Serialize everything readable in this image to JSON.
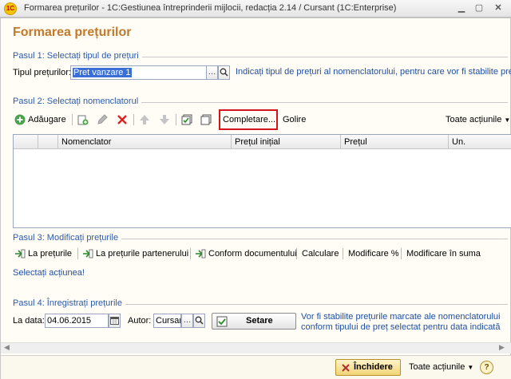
{
  "window": {
    "title": "Formarea prețurilor - 1C:Gestiunea întreprinderii mijlocii, redacția 2.14 / Cursant  (1C:Enterprise)",
    "logo_text": "1С"
  },
  "form": {
    "title": "Formarea prețurilor"
  },
  "step1": {
    "label": "Pasul 1: Selectați tipul de prețuri",
    "field_label": "Tipul prețurilor:",
    "field_value": "Pret vanzare 1",
    "hint": "Indicați tipul de prețuri al nomenclatorului, pentru care vor fi stabilite prețurile"
  },
  "step2": {
    "label": "Pasul 2: Selectați nomenclatorul",
    "add_label": "Adăugare",
    "fill_label": "Completare...",
    "clear_label": "Golire",
    "all_actions": "Toate acțiunile",
    "columns": [
      "Nomenclator",
      "Prețul inițial",
      "Prețul",
      "Un."
    ]
  },
  "step3": {
    "label": "Pasul 3: Modificați prețurile",
    "buttons": [
      "La prețurile",
      "La prețurile partenerului",
      "Conform documentului",
      "Calculare",
      "Modificare %",
      "Modificare în suma"
    ],
    "select_action": "Selectați acțiunea!"
  },
  "step4": {
    "label": "Pasul 4: Înregistrați prețurile",
    "date_label": "La data:",
    "date_value": "04.06.2015",
    "author_label": "Autor:",
    "author_value": "Cursant",
    "set_label": "Setare",
    "hint": "Vor fi stabilite prețurile marcate ale nomenclatorului conform tipului de preț selectat pentru data indicată"
  },
  "footer": {
    "close_label": "Închidere",
    "all_actions": "Toate acțiunile",
    "help": "?"
  },
  "colors": {
    "title": "#c1792b",
    "link": "#1f4fa3",
    "highlight": "#d4141b"
  }
}
